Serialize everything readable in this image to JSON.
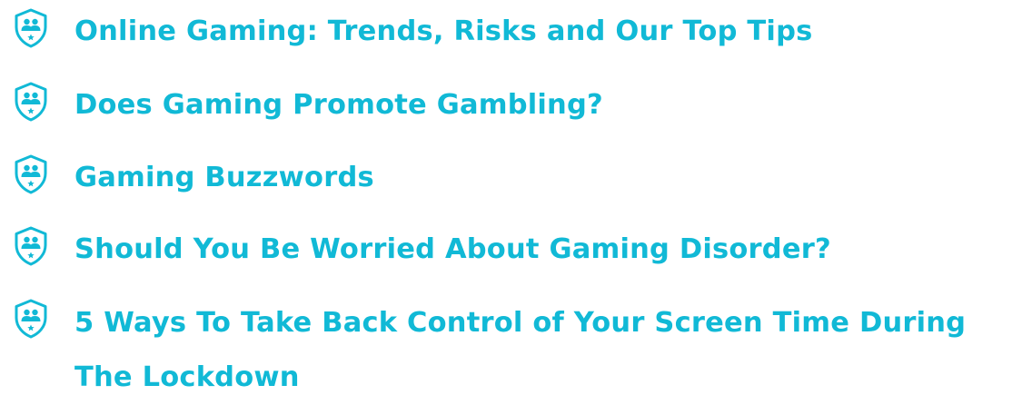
{
  "accent_color": "#11b9d6",
  "icon": "shield-people-star-icon",
  "links": [
    {
      "label": "Online Gaming: Trends, Risks and Our Top Tips"
    },
    {
      "label": "Does Gaming Promote Gambling?"
    },
    {
      "label": "Gaming Buzzwords"
    },
    {
      "label": "Should You Be Worried About Gaming Disorder?"
    },
    {
      "label": "5 Ways To Take Back Control of Your Screen Time During The Lockdown"
    }
  ]
}
